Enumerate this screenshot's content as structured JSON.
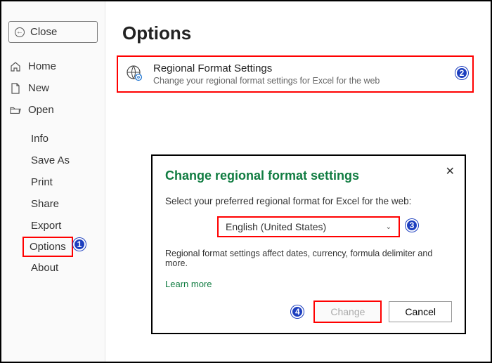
{
  "sidebar": {
    "close": "Close",
    "home": "Home",
    "newdoc": "New",
    "open": "Open",
    "info": "Info",
    "saveas": "Save As",
    "print": "Print",
    "share": "Share",
    "export": "Export",
    "options": "Options",
    "about": "About"
  },
  "main": {
    "heading": "Options",
    "tile_title": "Regional Format Settings",
    "tile_sub": "Change your regional format settings for Excel for the web"
  },
  "dialog": {
    "title": "Change regional format settings",
    "prompt": "Select your preferred regional format for Excel for the web:",
    "selected": "English (United States)",
    "note": "Regional format settings affect dates, currency, formula delimiter and more.",
    "learn": "Learn more",
    "change_btn": "Change",
    "cancel_btn": "Cancel"
  },
  "badges": {
    "b1": "1",
    "b2": "2",
    "b3": "3",
    "b4": "4"
  }
}
